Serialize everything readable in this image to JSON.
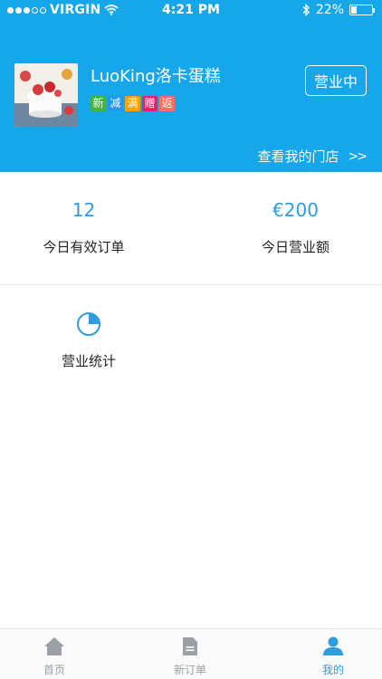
{
  "status_bar": {
    "carrier": "VIRGIN",
    "time": "4:21 PM",
    "battery_text": "22%"
  },
  "store": {
    "name": "LuoKing洛卡蛋糕",
    "promo_tags": [
      "新",
      "减",
      "满",
      "赠",
      "返"
    ],
    "status_button": "营业中",
    "view_stores": "查看我的门店",
    "view_stores_chevron": ">>"
  },
  "stats": {
    "valid_orders": {
      "value": "12",
      "label": "今日有效订单"
    },
    "revenue": {
      "value": "€200",
      "label": "今日营业额"
    }
  },
  "quick_entry": {
    "label": "营业统计",
    "icon": "pie-chart-icon"
  },
  "tabbar": {
    "items": [
      {
        "label": "首页",
        "icon": "home-icon"
      },
      {
        "label": "新订单",
        "icon": "document-icon"
      },
      {
        "label": "我的",
        "icon": "user-icon",
        "active": true
      }
    ]
  },
  "colors": {
    "header_bg": "#16a6ea",
    "accent": "#2e9cdf",
    "tab_inactive": "#9aa0a6"
  }
}
